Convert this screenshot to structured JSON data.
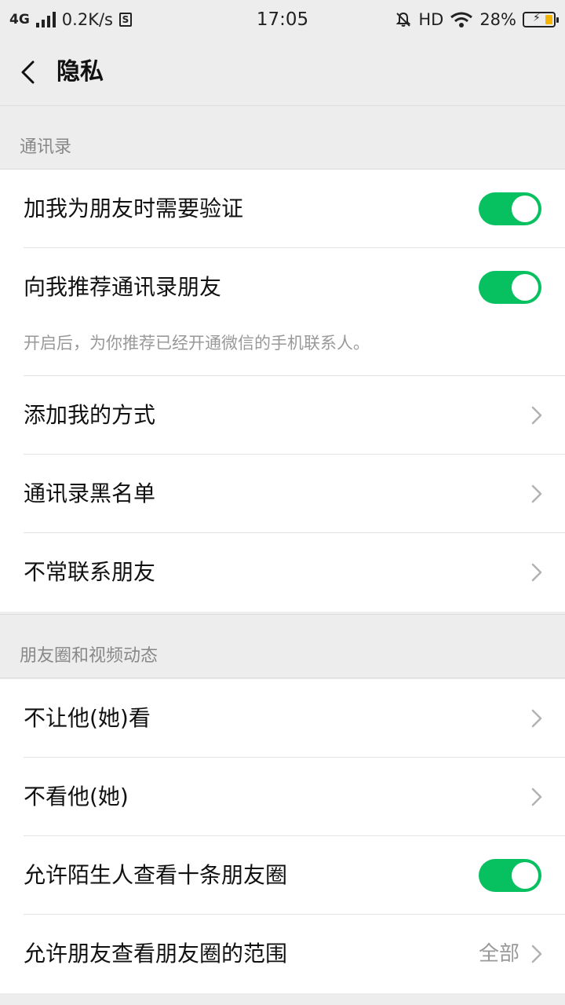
{
  "status_bar": {
    "network": "4G",
    "speed": "0.2K/s",
    "sim_label": "S",
    "time": "17:05",
    "hd": "HD",
    "battery": "28%",
    "battery_fill_color": "#f5b400"
  },
  "header": {
    "title": "隐私"
  },
  "sections": {
    "contacts": {
      "title": "通讯录",
      "items": [
        {
          "label": "加我为朋友时需要验证",
          "toggle": true
        },
        {
          "label": "向我推荐通讯录朋友",
          "toggle": true,
          "description": "开启后，为你推荐已经开通微信的手机联系人。"
        },
        {
          "label": "添加我的方式"
        },
        {
          "label": "通讯录黑名单"
        },
        {
          "label": "不常联系朋友"
        }
      ]
    },
    "moments": {
      "title": "朋友圈和视频动态",
      "items": [
        {
          "label": "不让他(她)看"
        },
        {
          "label": "不看他(她)"
        },
        {
          "label": "允许陌生人查看十条朋友圈",
          "toggle": true
        },
        {
          "label": "允许朋友查看朋友圈的范围",
          "value": "全部"
        }
      ]
    }
  },
  "colors": {
    "accent": "#07c160",
    "background": "#ededed",
    "secondary_text": "#999999"
  }
}
